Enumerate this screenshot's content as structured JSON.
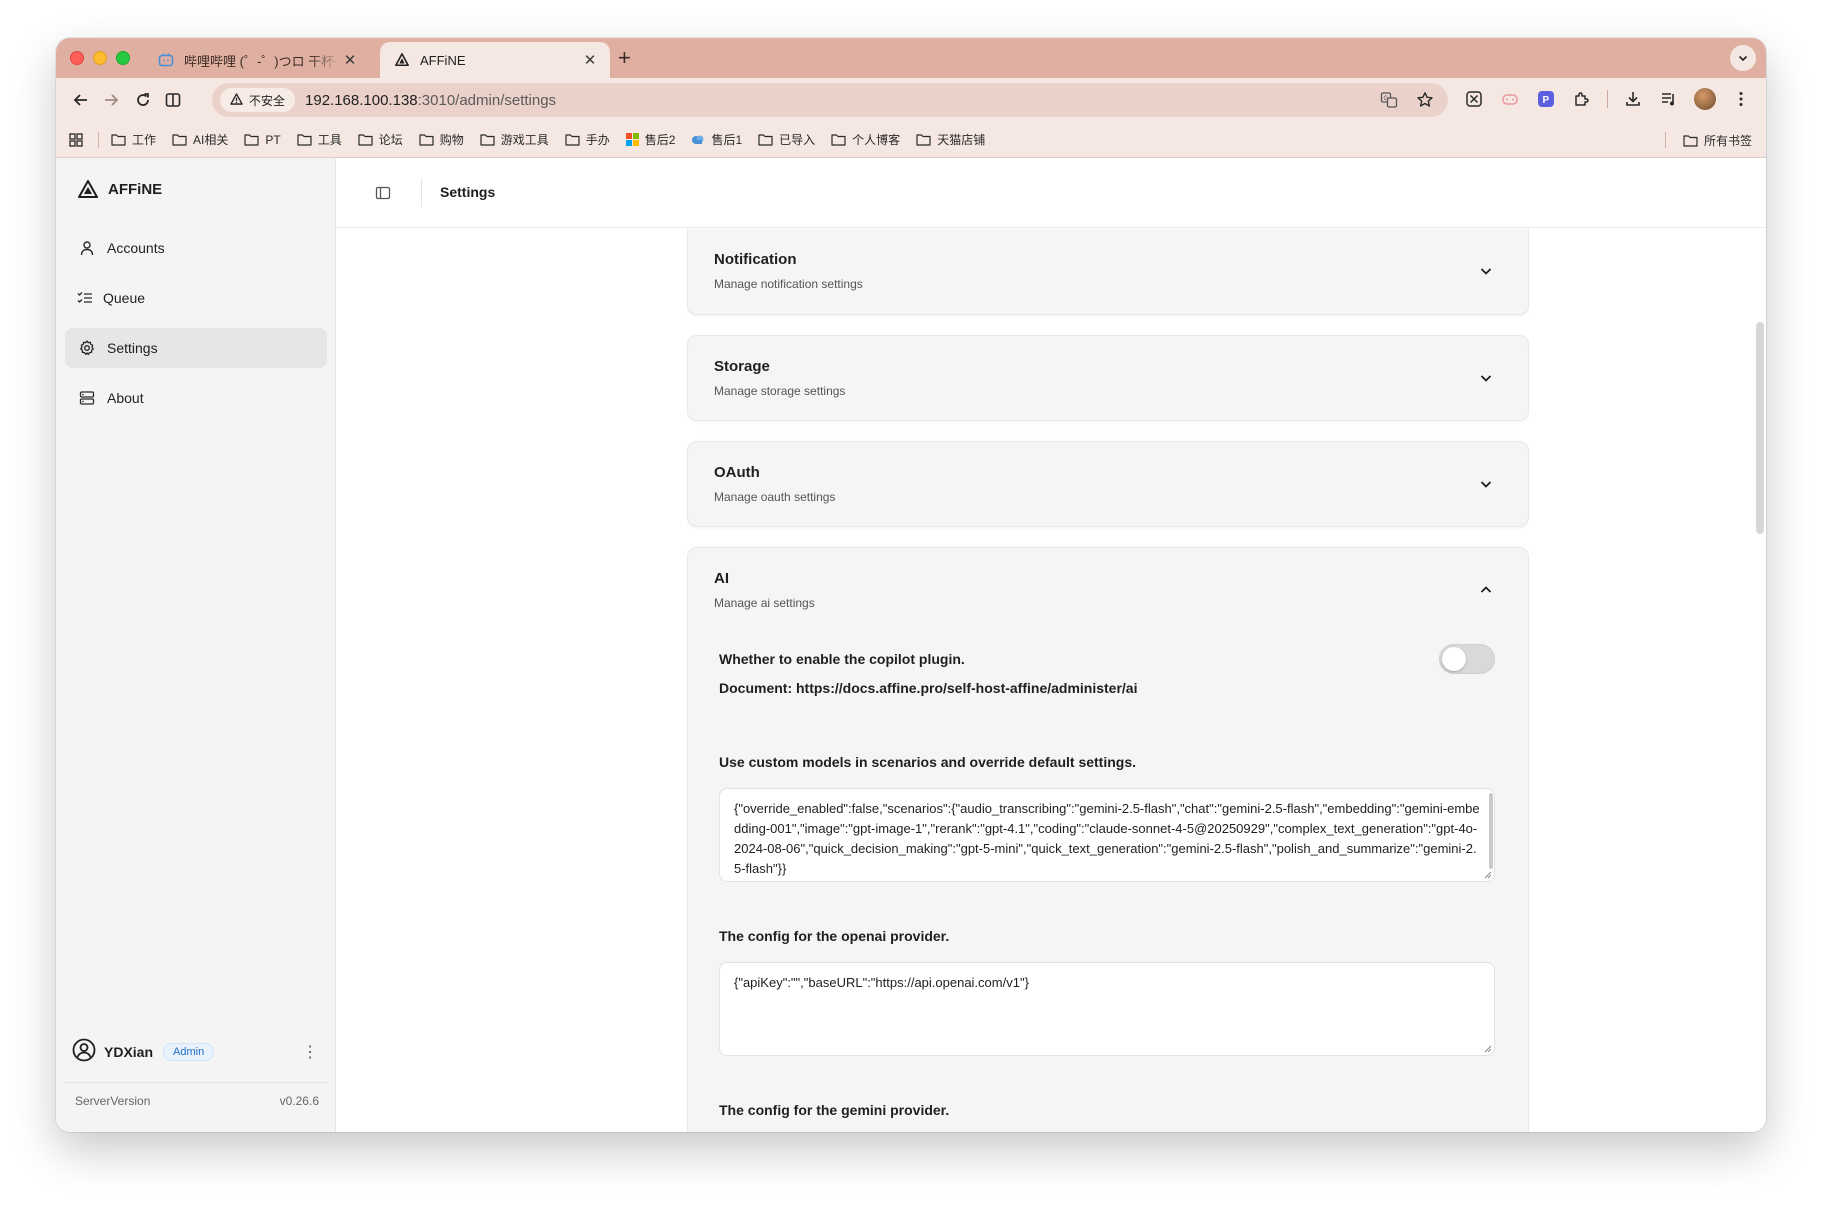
{
  "browser": {
    "tabs": [
      {
        "title": "哔哩哔哩 (゜-゜)つロ 干杯~-bilibili",
        "active": false
      },
      {
        "title": "AFFiNE",
        "active": true
      }
    ],
    "security_label": "不安全",
    "url_host": "192.168.100.138",
    "url_rest": ":3010/admin/settings",
    "bookmarks": [
      "工作",
      "AI相关",
      "PT",
      "工具",
      "论坛",
      "购物",
      "游戏工具",
      "手办",
      "售后2",
      "售后1",
      "已导入",
      "个人博客",
      "天猫店铺"
    ],
    "all_bookmarks_label": "所有书签"
  },
  "sidebar": {
    "brand": "AFFiNE",
    "nav": [
      {
        "label": "Accounts",
        "icon": "user-icon",
        "active": false
      },
      {
        "label": "Queue",
        "icon": "list-check-icon",
        "active": false
      },
      {
        "label": "Settings",
        "icon": "gear-icon",
        "active": true
      },
      {
        "label": "About",
        "icon": "server-icon",
        "active": false
      }
    ],
    "user_name": "YDXian",
    "user_role": "Admin",
    "version_label": "ServerVersion",
    "version_value": "v0.26.6"
  },
  "header": {
    "title": "Settings"
  },
  "sections": [
    {
      "title": "Notification",
      "description": "Manage notification settings"
    },
    {
      "title": "Storage",
      "description": "Manage storage settings"
    },
    {
      "title": "OAuth",
      "description": "Manage oauth settings"
    }
  ],
  "ai": {
    "title": "AI",
    "description": "Manage ai settings",
    "copilot_label": "Whether to enable the copilot plugin.",
    "copilot_enabled": false,
    "document_line": "Document: https://docs.affine.pro/self-host-affine/administer/ai",
    "custom_models_label": "Use custom models in scenarios and override default settings.",
    "custom_models_value": "{\"override_enabled\":false,\"scenarios\":{\"audio_transcribing\":\"gemini-2.5-flash\",\"chat\":\"gemini-2.5-flash\",\"embedding\":\"gemini-embedding-001\",\"image\":\"gpt-image-1\",\"rerank\":\"gpt-4.1\",\"coding\":\"claude-sonnet-4-5@20250929\",\"complex_text_generation\":\"gpt-4o-2024-08-06\",\"quick_decision_making\":\"gpt-5-mini\",\"quick_text_generation\":\"gemini-2.5-flash\",\"polish_and_summarize\":\"gemini-2.5-flash\"}}",
    "openai_label": "The config for the openai provider.",
    "openai_value": "{\"apiKey\":\"\",\"baseURL\":\"https://api.openai.com/v1\"}",
    "gemini_label": "The config for the gemini provider."
  }
}
